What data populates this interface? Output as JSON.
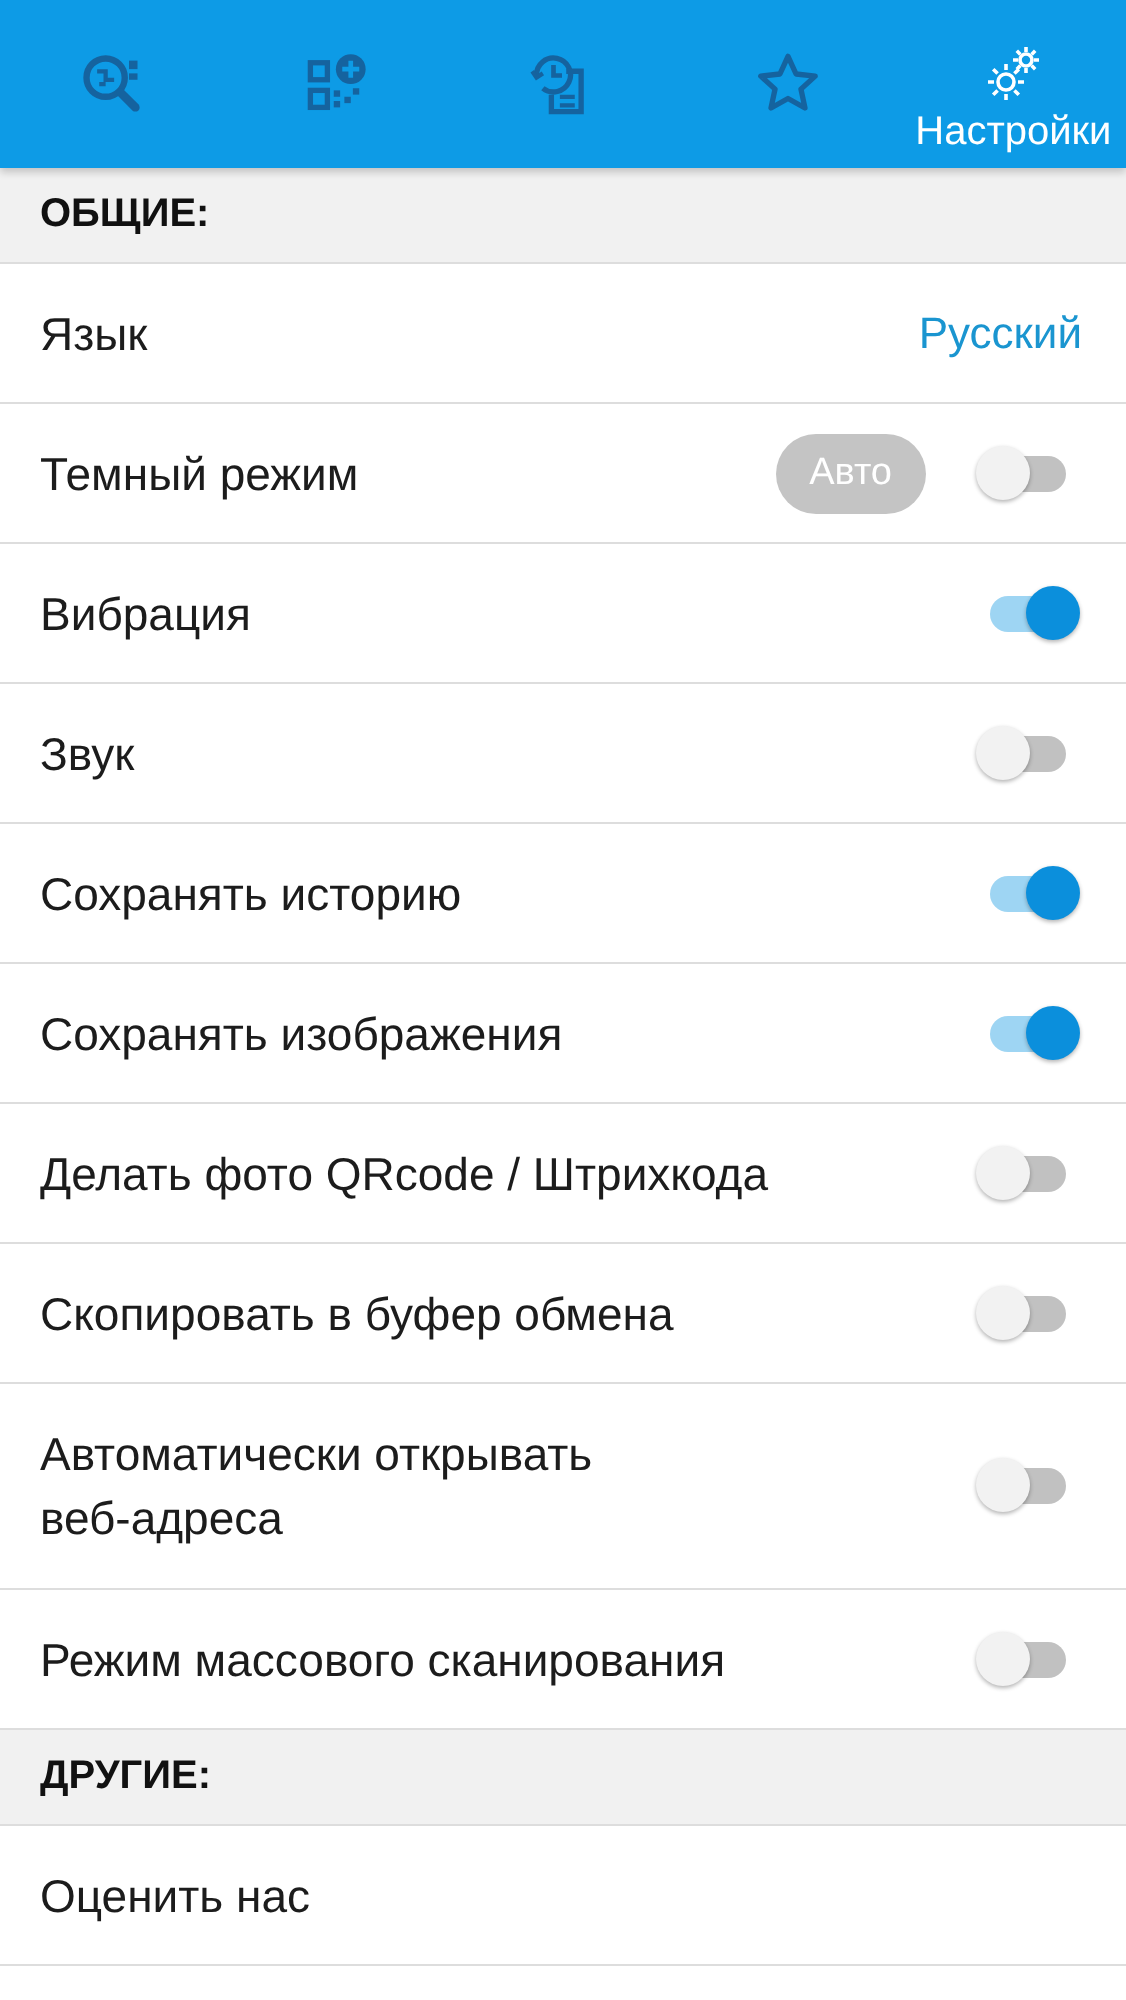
{
  "tabs": [
    {
      "kind": "scan",
      "selected": false
    },
    {
      "kind": "create",
      "selected": false
    },
    {
      "kind": "history",
      "selected": false
    },
    {
      "kind": "favorites",
      "selected": false
    },
    {
      "kind": "settings",
      "selected": true,
      "label": "Настройки"
    }
  ],
  "sections": [
    {
      "title": "ОБЩИЕ:",
      "items": [
        {
          "kind": "value",
          "label": "Язык",
          "value": "Русский"
        },
        {
          "kind": "toggle",
          "label": "Темный режим",
          "badge": "Авто",
          "on": false
        },
        {
          "kind": "toggle",
          "label": "Вибрация",
          "on": true
        },
        {
          "kind": "toggle",
          "label": "Звук",
          "on": false
        },
        {
          "kind": "toggle",
          "label": "Сохранять историю",
          "on": true
        },
        {
          "kind": "toggle",
          "label": "Сохранять изображения",
          "on": true
        },
        {
          "kind": "toggle",
          "label": "Делать фото QRcode / Штрихкода",
          "on": false
        },
        {
          "kind": "toggle",
          "label": "Скопировать в буфер обмена",
          "on": false
        },
        {
          "kind": "toggle",
          "label": "Автоматически открывать веб-адреса",
          "on": false
        },
        {
          "kind": "toggle",
          "label": "Режим массового сканирования",
          "on": false
        }
      ]
    },
    {
      "title": "ДРУГИЕ:",
      "items": [
        {
          "kind": "link",
          "label": "Оценить нас"
        }
      ]
    }
  ]
}
